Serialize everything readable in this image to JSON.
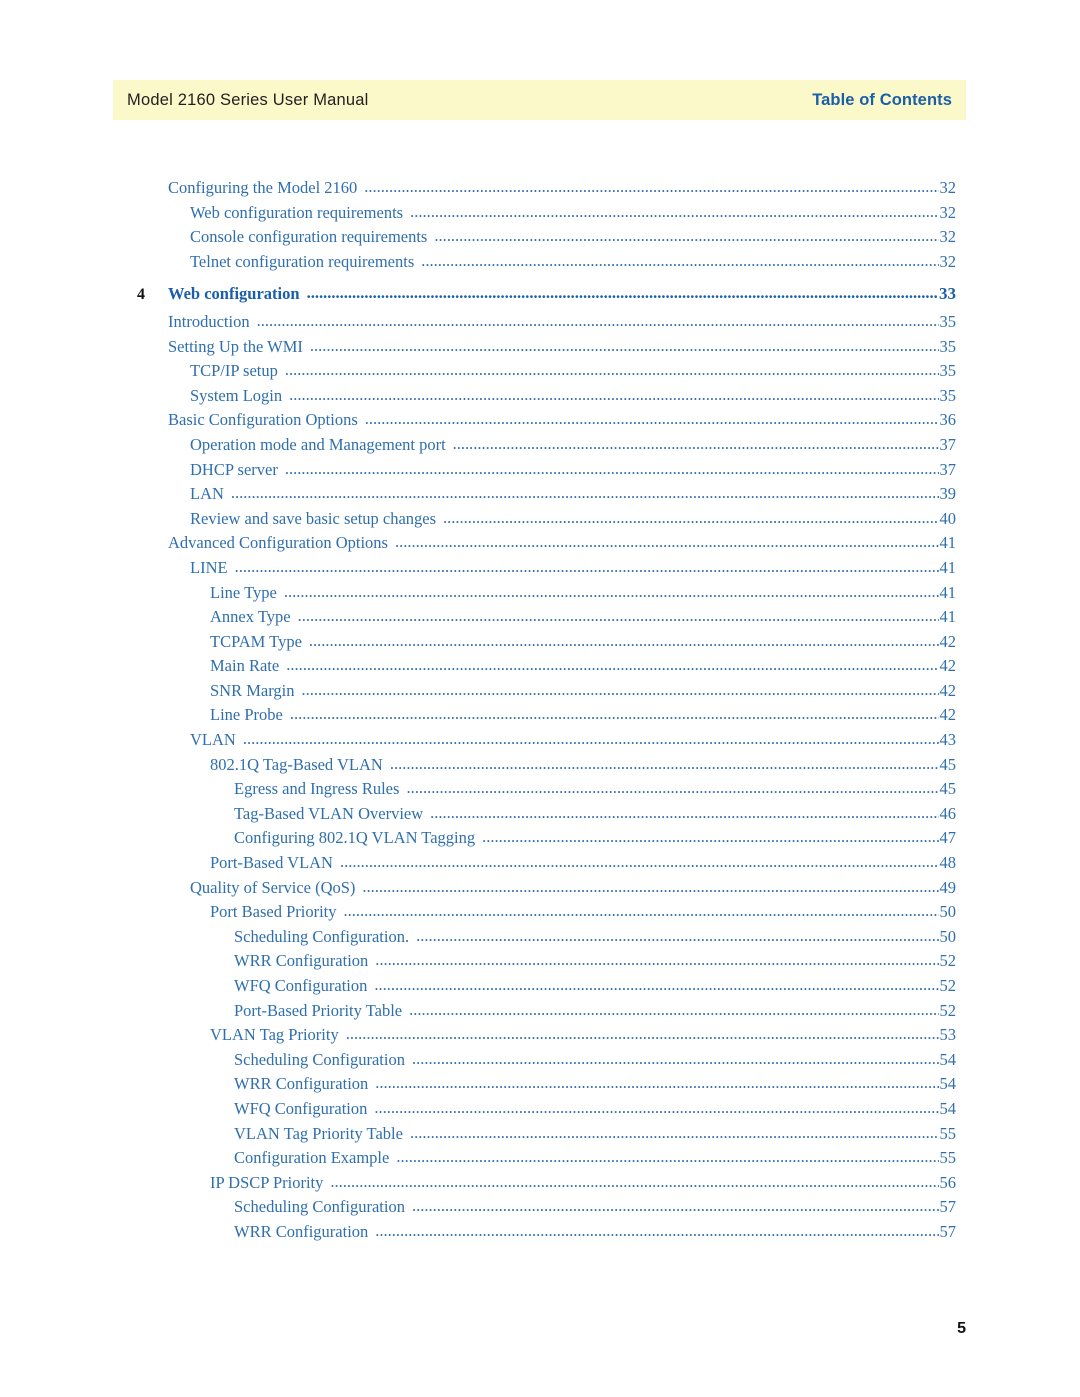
{
  "header": {
    "manual_title": "Model 2160 Series User Manual",
    "section_title": "Table of Contents",
    "band_color": "#fbf8c9",
    "accent_color": "#1a5fa8"
  },
  "toc": {
    "entry_color": "#2f6fad",
    "entries": [
      {
        "level": 0,
        "title": "Configuring the Model 2160",
        "page": "32"
      },
      {
        "level": 1,
        "title": "Web configuration requirements",
        "page": "32"
      },
      {
        "level": 1,
        "title": "Console configuration requirements",
        "page": "32"
      },
      {
        "level": 1,
        "title": "Telnet configuration requirements",
        "page": "32"
      },
      {
        "level": 0,
        "chapter": "4",
        "title": "Web configuration",
        "page": "33",
        "bold": true
      },
      {
        "level": 0,
        "title": "Introduction",
        "page": "35"
      },
      {
        "level": 0,
        "title": "Setting Up the WMI",
        "page": "35"
      },
      {
        "level": 1,
        "title": "TCP/IP setup",
        "page": "35"
      },
      {
        "level": 1,
        "title": "System Login",
        "page": "35"
      },
      {
        "level": 0,
        "title": "Basic Configuration Options",
        "page": "36"
      },
      {
        "level": 1,
        "title": "Operation mode and Management port",
        "page": "37"
      },
      {
        "level": 1,
        "title": "DHCP server",
        "page": "37"
      },
      {
        "level": 1,
        "title": "LAN",
        "page": "39"
      },
      {
        "level": 1,
        "title": "Review and save basic setup changes",
        "page": "40"
      },
      {
        "level": 0,
        "title": "Advanced Configuration Options",
        "page": "41"
      },
      {
        "level": 1,
        "title": "LINE",
        "page": "41"
      },
      {
        "level": 2,
        "title": "Line Type",
        "page": "41"
      },
      {
        "level": 2,
        "title": "Annex Type",
        "page": "41"
      },
      {
        "level": 2,
        "title": "TCPAM Type",
        "page": "42"
      },
      {
        "level": 2,
        "title": "Main Rate",
        "page": "42"
      },
      {
        "level": 2,
        "title": "SNR Margin",
        "page": "42"
      },
      {
        "level": 2,
        "title": "Line Probe",
        "page": "42"
      },
      {
        "level": 1,
        "title": "VLAN",
        "page": "43"
      },
      {
        "level": 2,
        "title": "802.1Q Tag-Based VLAN",
        "page": "45"
      },
      {
        "level": 3,
        "title": "Egress and Ingress Rules",
        "page": "45"
      },
      {
        "level": 3,
        "title": "Tag-Based VLAN Overview",
        "page": "46"
      },
      {
        "level": 3,
        "title": "Configuring 802.1Q VLAN Tagging",
        "page": "47"
      },
      {
        "level": 2,
        "title": "Port-Based VLAN",
        "page": "48"
      },
      {
        "level": 1,
        "title": "Quality of Service (QoS)",
        "page": "49"
      },
      {
        "level": 2,
        "title": "Port Based Priority",
        "page": "50"
      },
      {
        "level": 3,
        "title": "Scheduling Configuration.",
        "page": "50"
      },
      {
        "level": 3,
        "title": "WRR Configuration",
        "page": "52"
      },
      {
        "level": 3,
        "title": "WFQ Configuration",
        "page": "52"
      },
      {
        "level": 3,
        "title": "Port-Based Priority Table",
        "page": "52"
      },
      {
        "level": 2,
        "title": "VLAN Tag Priority",
        "page": "53"
      },
      {
        "level": 3,
        "title": "Scheduling Configuration",
        "page": "54"
      },
      {
        "level": 3,
        "title": "WRR Configuration",
        "page": "54"
      },
      {
        "level": 3,
        "title": "WFQ Configuration",
        "page": "54"
      },
      {
        "level": 3,
        "title": "VLAN Tag Priority Table",
        "page": "55"
      },
      {
        "level": 3,
        "title": "Configuration Example",
        "page": "55"
      },
      {
        "level": 2,
        "title": "IP DSCP Priority",
        "page": "56"
      },
      {
        "level": 3,
        "title": "Scheduling Configuration",
        "page": "57"
      },
      {
        "level": 3,
        "title": "WRR Configuration",
        "page": "57"
      }
    ]
  },
  "footer": {
    "page_number": "5"
  }
}
